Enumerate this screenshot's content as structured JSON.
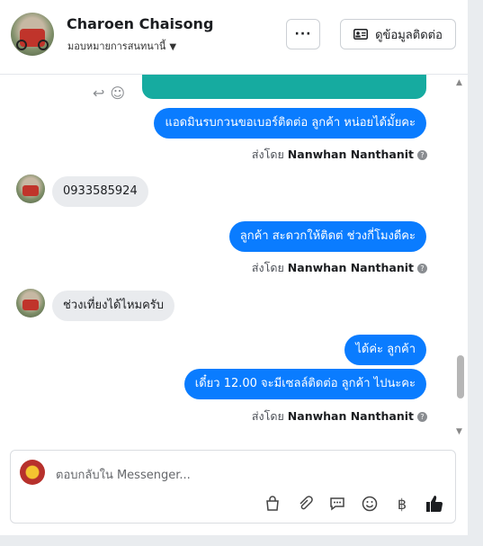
{
  "header": {
    "contact_name": "Charoen Chaisong",
    "assigned_status": "มอบหมายการสนทนานี้",
    "more_label": "···",
    "info_button_label": "ดูข้อมูลติดต่อ"
  },
  "messages": [
    {
      "type": "out",
      "text": "แอดมินรบกวนขอเบอร์ติดต่อ ลูกค้า  หน่อยได้มั้ยคะ"
    },
    {
      "type": "in",
      "text": "0933585924"
    },
    {
      "type": "out",
      "text": "ลูกค้า  สะดวกให้ติดต่ ช่วงกี่โมงดีคะ"
    },
    {
      "type": "in",
      "text": "ช่วงเที่ยงได้ไหมครับ"
    },
    {
      "type": "out",
      "text": "ได้ค่ะ  ลูกค้า"
    },
    {
      "type": "out",
      "text": "เดี๋ยว 12.00 จะมีเซลล์ติดต่อ ลูกค้า  ไปนะคะ"
    }
  ],
  "sent_by": {
    "prefix": "ส่งโดย",
    "name": "Nanwhan Nanthanit",
    "help": "?"
  },
  "composer": {
    "placeholder": "ตอบกลับใน Messenger..."
  },
  "icons": {
    "more": "ellipsis-icon",
    "contact": "contact-card-icon",
    "reply": "reply-icon",
    "emoji": "smile-icon",
    "bag": "shopping-bag-icon",
    "attach": "paperclip-icon",
    "chat": "chat-bubble-icon",
    "baht": "baht-icon",
    "like": "thumbs-up-icon"
  },
  "colors": {
    "outgoing": "#0a7cff",
    "incoming": "#e9ebee"
  }
}
